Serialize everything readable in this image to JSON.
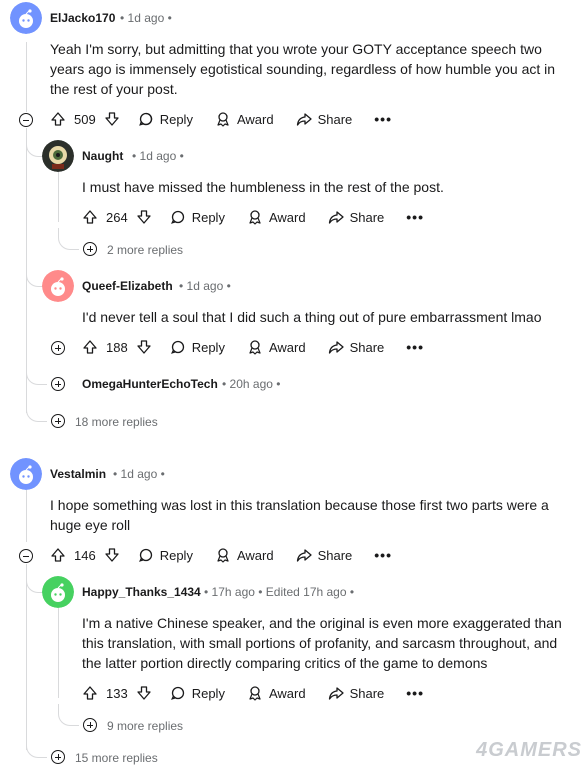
{
  "comments": [
    {
      "username": "ElJacko170",
      "meta": "• 1d ago •",
      "text": "Yeah I'm sorry, but admitting that you wrote your GOTY acceptance speech two years ago is immensely egotistical sounding, regardless of how humble you act in the rest of your post.",
      "votes": "509",
      "avatar_color": "#7193ff"
    },
    {
      "username": "Naught",
      "meta": "• 1d ago •",
      "text": "I must have missed the humbleness in the rest of the post.",
      "votes": "264",
      "more_replies": "2 more replies",
      "avatar_color": "#2b2f2a"
    },
    {
      "username": "Queef-Elizabeth",
      "meta": "• 1d ago •",
      "text": "I'd never tell a soul that I did such a thing out of pure embarrassment lmao",
      "votes": "188",
      "avatar_color": "#ff8a8a"
    },
    {
      "username": "OmegaHunterEchoTech",
      "meta": "• 20h ago •"
    },
    {
      "username": "Vestalmin",
      "meta": "• 1d ago •",
      "text": "I hope something was lost in this translation because those first two parts were a huge eye roll",
      "votes": "146",
      "avatar_color": "#7193ff"
    },
    {
      "username": "Happy_Thanks_1434",
      "meta": "• 17h ago • Edited 17h ago •",
      "text": "I'm a native Chinese speaker, and the original is even more exaggerated than this translation, with small portions of profanity, and sarcasm throughout, and the latter portion directly comparing critics of the game to demons",
      "votes": "133",
      "more_replies": "9 more replies",
      "avatar_color": "#46d160"
    }
  ],
  "thread_more_1": "18 more replies",
  "thread_more_2": "15 more replies",
  "actions": {
    "reply": "Reply",
    "award": "Award",
    "share": "Share",
    "overflow": "•••"
  },
  "watermark": "4GAMERS"
}
